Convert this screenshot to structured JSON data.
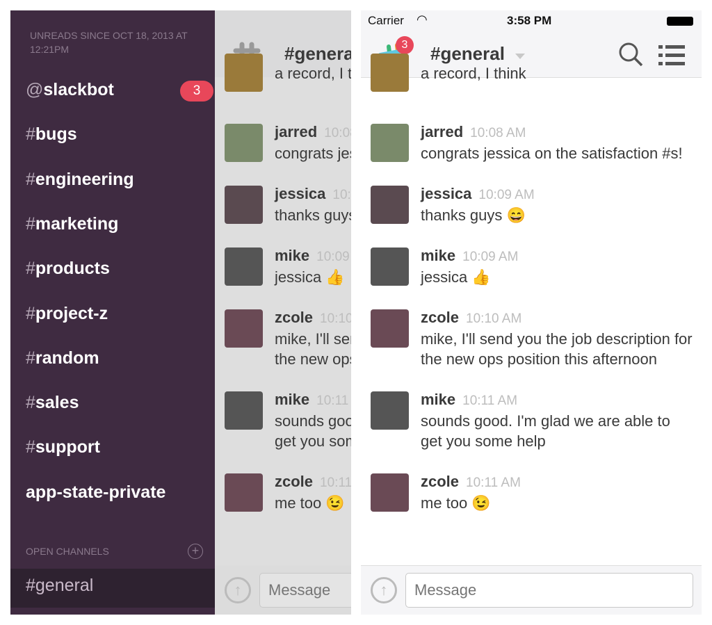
{
  "sidebar": {
    "unreads_header": "Unreads since Oct 18, 2013 at 12:21PM",
    "channels": [
      {
        "prefix": "@",
        "name": "slackbot",
        "badge": "3"
      },
      {
        "prefix": "#",
        "name": "bugs"
      },
      {
        "prefix": "#",
        "name": "engineering"
      },
      {
        "prefix": "#",
        "name": "marketing"
      },
      {
        "prefix": "#",
        "name": "products"
      },
      {
        "prefix": "#",
        "name": "project-z"
      },
      {
        "prefix": "#",
        "name": "random"
      },
      {
        "prefix": "#",
        "name": "sales"
      },
      {
        "prefix": "#",
        "name": "support"
      },
      {
        "prefix": "",
        "name": "app-state-private"
      }
    ],
    "open_channels_label": "Open Channels",
    "add_icon": "plus-circle-icon",
    "active_channel": "#general",
    "bg_color": "#3f2b41",
    "badge_color": "#e8475a"
  },
  "status": {
    "carrier": "Carrier",
    "time": "3:58 PM"
  },
  "header": {
    "title": "#general",
    "notification_count": "3"
  },
  "messages": [
    {
      "user": "",
      "time": "",
      "text": "a record, I think",
      "color": "#9a7a3a"
    },
    {
      "user": "jarred",
      "time": "10:08 AM",
      "text": "congrats jessica on the satisfaction #s!",
      "color": "#7a8a6a"
    },
    {
      "user": "jessica",
      "time": "10:09 AM",
      "text": "thanks guys 😄",
      "color": "#5a4a50"
    },
    {
      "user": "mike",
      "time": "10:09 AM",
      "text": "jessica 👍",
      "color": "#555555"
    },
    {
      "user": "zcole",
      "time": "10:10 AM",
      "text": "mike, I'll send you the job description for the new ops position this afternoon",
      "color": "#6a4a55"
    },
    {
      "user": "mike",
      "time": "10:11 AM",
      "text": "sounds good. I'm glad we are able to get you some help",
      "color": "#555555"
    },
    {
      "user": "zcole",
      "time": "10:11 AM",
      "text": "me too 😉",
      "color": "#6a4a55"
    }
  ],
  "composer": {
    "placeholder": "Message"
  }
}
